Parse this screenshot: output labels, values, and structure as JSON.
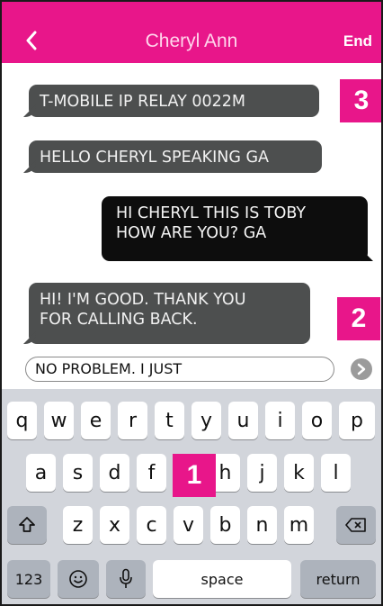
{
  "header": {
    "title": "Cheryl Ann",
    "end_label": "End",
    "back_icon": "chevron-left-icon"
  },
  "messages": [
    {
      "direction": "incoming",
      "lines": [
        "T-MOBILE IP RELAY 0022M"
      ]
    },
    {
      "direction": "incoming",
      "lines": [
        "HELLO CHERYL SPEAKING GA"
      ]
    },
    {
      "direction": "outgoing",
      "lines": [
        "HI CHERYL THIS IS TOBY",
        "HOW ARE YOU? GA"
      ]
    },
    {
      "direction": "incoming",
      "lines": [
        "HI!  I'M GOOD. THANK YOU",
        "FOR CALLING BACK."
      ]
    }
  ],
  "badges": {
    "b1": "1",
    "b2": "2",
    "b3": "3"
  },
  "input": {
    "value": "NO PROBLEM. I JUST",
    "send_icon": "send-arrow-icon"
  },
  "keyboard": {
    "row1": [
      "q",
      "w",
      "e",
      "r",
      "t",
      "y",
      "u",
      "i",
      "o",
      "p"
    ],
    "row2": [
      "a",
      "s",
      "d",
      "f",
      "g",
      "h",
      "j",
      "k",
      "l"
    ],
    "row3": [
      "z",
      "x",
      "c",
      "v",
      "b",
      "n",
      "m"
    ],
    "shift_icon": "shift-icon",
    "delete_icon": "delete-icon",
    "numbers_label": "123",
    "emoji_icon": "emoji-icon",
    "mic_icon": "microphone-icon",
    "space_label": "space",
    "return_label": "return"
  },
  "colors": {
    "accent": "#e8168a",
    "incoming_bubble": "#4d4f4f",
    "outgoing_bubble": "#0d0d0d",
    "keyboard_bg": "#d2d5db"
  }
}
